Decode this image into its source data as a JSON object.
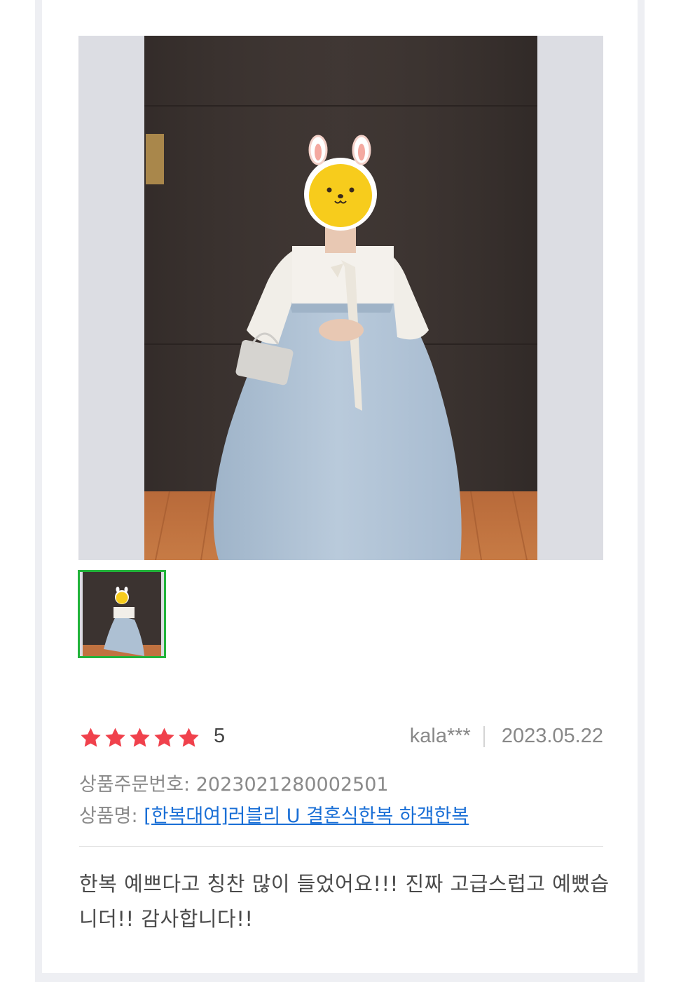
{
  "review": {
    "rating": {
      "stars": 5,
      "score": "5",
      "star_color": "#f0414c"
    },
    "author": "kala***",
    "date": "2023.05.22",
    "order_label": "상품주문번호:",
    "order_number": "2023021280002501",
    "product_label": "상품명:",
    "product_name": "[한복대여]러블리 U 결혼식한복 하객한복",
    "text": "한복 예쁘다고 칭찬 많이 들었어요!!! 진짜 고급스럽고 예뻤습니더!! 감사합니다!!"
  },
  "colors": {
    "accent_link": "#1a6fd6",
    "thumb_selected_border": "#22b33a",
    "background": "#ffffff",
    "frame": "#eeeff3"
  }
}
